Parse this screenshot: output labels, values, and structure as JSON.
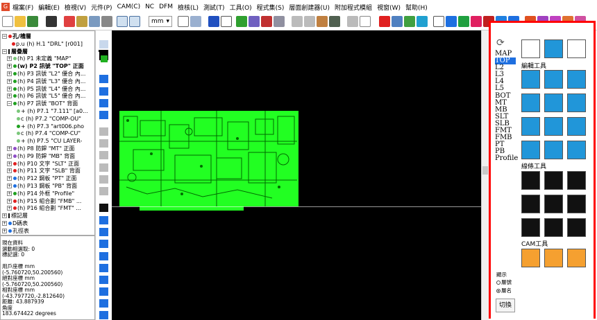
{
  "app": {
    "logo": "G"
  },
  "menu": [
    "檔案(F)",
    "編輯(E)",
    "檢視(V)",
    "元件(P)",
    "CAM(C)",
    "NC",
    "DFM",
    "檢核(L)",
    "測試(T)",
    "工具(O)",
    "程式集(S)",
    "層面創建器(U)",
    "附加程式模組",
    "視窗(W)",
    "幫助(H)"
  ],
  "toolbar": {
    "unit": "mm"
  },
  "tree": [
    {
      "exp": "⊟",
      "icon": "dot",
      "color": "#e02020",
      "label": "孔/槽層",
      "indent": 0,
      "bold": true
    },
    {
      "exp": "",
      "icon": "dot",
      "color": "#e02020",
      "label": "p.u (h) H.1 \"DRL\" [r001]",
      "indent": 2
    },
    {
      "exp": "⊟",
      "icon": "bar",
      "color": "#111",
      "label": "層疊層",
      "indent": 0,
      "bold": true
    },
    {
      "exp": "⊞",
      "icon": "dot",
      "color": "#7ac67a",
      "label": "(h) P1 未定義 \"MAP\"",
      "indent": 1
    },
    {
      "exp": "⊞",
      "icon": "dot",
      "color": "#20a020",
      "label": "(w) P2 訊號 \"TOP\" 正面",
      "indent": 1,
      "bold": true
    },
    {
      "exp": "⊞",
      "icon": "dot",
      "color": "#20a020",
      "label": "(h) P3 訊號 \"L2\" 優合 內...",
      "indent": 1
    },
    {
      "exp": "⊞",
      "icon": "dot",
      "color": "#20a020",
      "label": "(h) P4 訊號 \"L3\" 優合 內...",
      "indent": 1
    },
    {
      "exp": "⊞",
      "icon": "dot",
      "color": "#20a020",
      "label": "(h) P5 訊號 \"L4\" 優合 內...",
      "indent": 1
    },
    {
      "exp": "⊞",
      "icon": "dot",
      "color": "#20a020",
      "label": "(h) P6 訊號 \"L5\" 優合 內...",
      "indent": 1
    },
    {
      "exp": "⊟",
      "icon": "dot",
      "color": "#20a020",
      "label": "(h) P7 訊號 \"BOT\" 背面",
      "indent": 1
    },
    {
      "exp": "",
      "icon": "dot",
      "color": "#7ac67a",
      "label": "+ (h) P7.1 \"7.111\" [a0...",
      "indent": 3
    },
    {
      "exp": "",
      "icon": "dot",
      "color": "#7ac67a",
      "label": "c (h) P7.2 \"COMP-OU\"",
      "indent": 3
    },
    {
      "exp": "",
      "icon": "dot",
      "color": "#20a020",
      "label": "+ (h) P7.3 \"art006.pho",
      "indent": 3
    },
    {
      "exp": "",
      "icon": "dot",
      "color": "#7ac67a",
      "label": "c (h) P7.4 \"COMP-CU\"",
      "indent": 3
    },
    {
      "exp": "",
      "icon": "dot",
      "color": "#7ac67a",
      "label": "+ (h) P7.5 \"CU LAYER-",
      "indent": 3
    },
    {
      "exp": "⊞",
      "icon": "dot",
      "color": "#8e4ec6",
      "label": "(h) P8 防銲 \"MT\" 正面",
      "indent": 1
    },
    {
      "exp": "⊞",
      "icon": "dot",
      "color": "#8e4ec6",
      "label": "(h) P9 防銲 \"MB\" 背面",
      "indent": 1
    },
    {
      "exp": "⊞",
      "icon": "dot",
      "color": "#e02020",
      "label": "(h) P10 文字 \"SLT\" 正面",
      "indent": 1
    },
    {
      "exp": "⊞",
      "icon": "dot",
      "color": "#e02020",
      "label": "(h) P11 文字 \"SLB\" 背面",
      "indent": 1
    },
    {
      "exp": "⊞",
      "icon": "dot",
      "color": "#1e6fe0",
      "label": "(h) P12 鋼板 \"PT\" 正面",
      "indent": 1
    },
    {
      "exp": "⊞",
      "icon": "dot",
      "color": "#1e6fe0",
      "label": "(h) P13 鋼板 \"PB\" 背面",
      "indent": 1
    },
    {
      "exp": "⊞",
      "icon": "dot",
      "color": "#20a020",
      "label": "(h) P14 外框 \"Profile\"",
      "indent": 1
    },
    {
      "exp": "⊞",
      "icon": "dot",
      "color": "#e02020",
      "label": "(h) P15 組合劃 \"FMB\" ...",
      "indent": 1
    },
    {
      "exp": "⊞",
      "icon": "dot",
      "color": "#e02020",
      "label": "(h) P16 組合劃 \"FMT\" ...",
      "indent": 1
    },
    {
      "exp": "⊞",
      "icon": "bar",
      "color": "#111",
      "label": "標記層",
      "indent": 0
    },
    {
      "exp": "⊞",
      "icon": "dot",
      "color": "#1e6fe0",
      "label": "D碼表",
      "indent": 0
    },
    {
      "exp": "⊞",
      "icon": "dot",
      "color": "#1e6fe0",
      "label": "孔徑表",
      "indent": 0
    }
  ],
  "info": [
    "現在資料",
    "選動相選取: 0",
    "標記選: 0",
    "",
    "用戶座標 mm",
    "(-5.760720,50.200560)",
    "絕對座標 mm",
    "(-5.760720,50.200560)",
    "相對座標 mm",
    "(-43.797720,-2.812640)",
    "距離: 43.887939",
    "角度",
    "183.674422 degrees"
  ],
  "layers": [
    "MAP",
    "TOP",
    "L2",
    "L3",
    "L4",
    "L5",
    "BOT",
    "MT",
    "MB",
    "SLT",
    "SLB",
    "FMT",
    "FMB",
    "PT",
    "PB",
    "Profile"
  ],
  "selected_layer": "TOP",
  "right": {
    "edit_label": "編輯工具",
    "line_label": "線條工具",
    "cam_label": "CAM工具",
    "display_label": "顯示",
    "radio_layer": "層號",
    "radio_name": "層名",
    "switch_button": "切換",
    "highlight_color": "#ff0000"
  }
}
